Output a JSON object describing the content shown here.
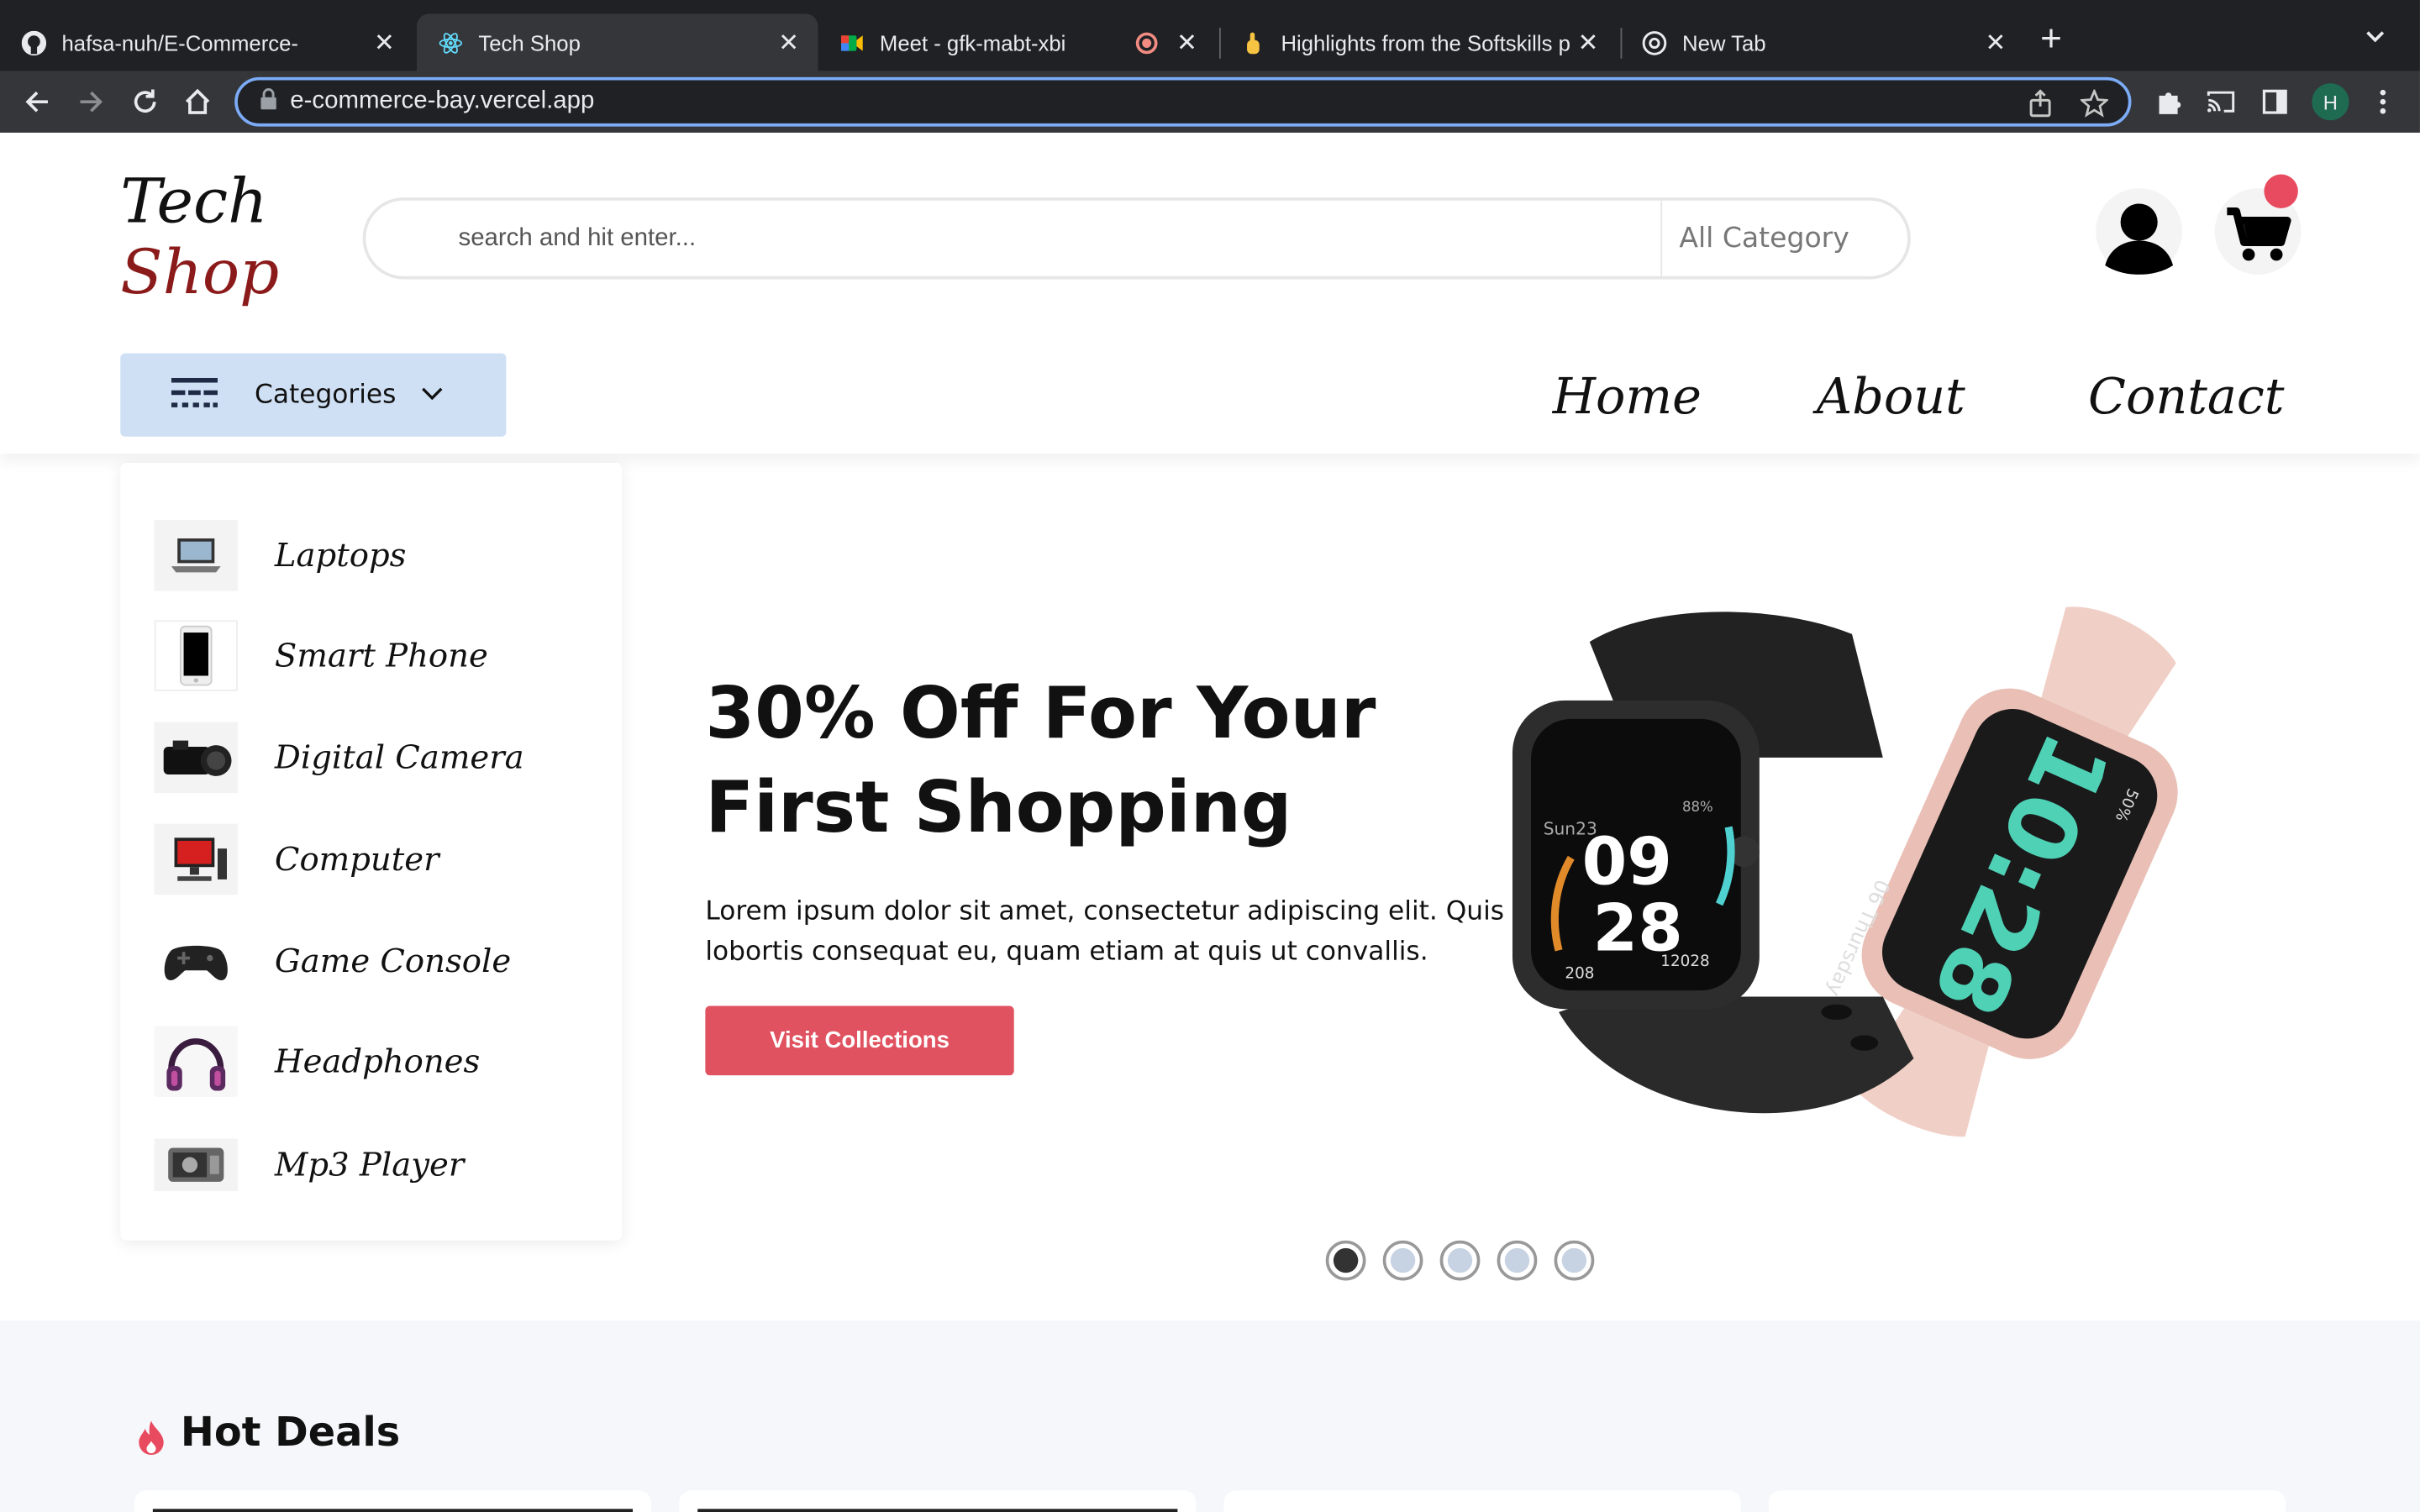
{
  "browser": {
    "tabs": [
      {
        "title": "hafsa-nuh/E-Commerce-",
        "icon": "github-icon"
      },
      {
        "title": "Tech Shop",
        "icon": "react-icon",
        "active": true
      },
      {
        "title": "Meet - gfk-mabt-xbi",
        "icon": "meet-icon"
      },
      {
        "title": "Highlights from the Softskills p",
        "icon": "thumbs-up-icon"
      },
      {
        "title": "New Tab",
        "icon": "chrome-icon"
      }
    ],
    "url": "e-commerce-bay.vercel.app",
    "profile_initial": "H"
  },
  "site": {
    "logo_line1": "Tech",
    "logo_line2": "Shop",
    "search_placeholder": "search and hit enter...",
    "category_select": "All Category",
    "categories_button": "Categories",
    "nav": [
      "Home",
      "About",
      "Contact"
    ]
  },
  "categories": [
    {
      "label": "Laptops",
      "icon": "laptop-icon"
    },
    {
      "label": "Smart Phone",
      "icon": "smartphone-icon"
    },
    {
      "label": "Digital Camera",
      "icon": "camera-icon"
    },
    {
      "label": "Computer",
      "icon": "computer-icon"
    },
    {
      "label": "Game Console",
      "icon": "gamepad-icon"
    },
    {
      "label": "Headphones",
      "icon": "headphones-icon"
    },
    {
      "label": "Mp3 Player",
      "icon": "mp3-player-icon"
    }
  ],
  "hero": {
    "title": "30% Off For Your First Shopping",
    "description": "Lorem ipsum dolor sit amet, consectetur adipiscing elit. Quis lobortis consequat eu, quam etiam at quis ut convallis.",
    "button": "Visit Collections",
    "watch_left": {
      "day": "Sun23",
      "hour": "09",
      "minute": "28",
      "battery": "88%",
      "steps": "12028",
      "calories": "208"
    },
    "watch_right": {
      "time": "10:28",
      "date": "06 Thursday",
      "battery": "50%"
    },
    "slides": 5,
    "active_slide": 1
  },
  "deals": {
    "title": "Hot Deals"
  },
  "colors": {
    "accent": "#e05260",
    "category_button": "#cfe0f5",
    "logo_shop": "#8b1a1a"
  }
}
